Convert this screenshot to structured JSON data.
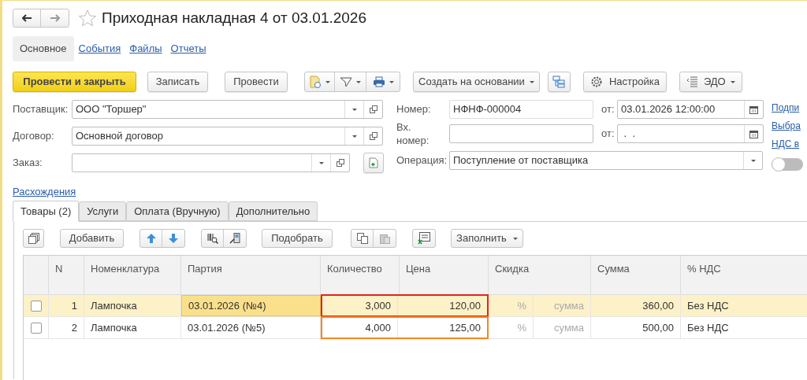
{
  "title": "Приходная накладная 4 от 03.01.2026",
  "sections": [
    {
      "label": "Основное",
      "selected": true
    },
    {
      "label": "События",
      "selected": false
    },
    {
      "label": "Файлы",
      "selected": false
    },
    {
      "label": "Отчеты",
      "selected": false
    }
  ],
  "toolbar": {
    "post_close": "Провести и закрыть",
    "save": "Записать",
    "post": "Провести",
    "create_based": "Создать на основании",
    "settings": "Настройка",
    "edo": "ЭДО"
  },
  "left_fields": [
    {
      "label": "Поставщик:",
      "value": "ООО \"Торшер\""
    },
    {
      "label": "Договор:",
      "value": "Основной договор"
    },
    {
      "label": "Заказ:"
    }
  ],
  "discrepancies_link": "Расхождения",
  "number": {
    "label": "Номер:",
    "value": "НФНФ-000004"
  },
  "date": {
    "label": "от:",
    "value": "03.01.2026 12:00:00"
  },
  "in_number": {
    "label": "Вх. номер:"
  },
  "in_date": {
    "label": "от:",
    "value": " .  ."
  },
  "operation": {
    "label": "Операция:",
    "value": "Поступление от поставщика"
  },
  "side_links": [
    "Подпи",
    "Выбра",
    "НДС в"
  ],
  "side_toggle": {
    "on": false
  },
  "tabs": [
    {
      "label": "Товары (2)",
      "selected": true
    },
    {
      "label": "Услуги",
      "selected": false
    },
    {
      "label": "Оплата (Вручную)",
      "selected": false
    },
    {
      "label": "Дополнительно",
      "selected": false
    }
  ],
  "table_toolbar": {
    "add": "Добавить",
    "pick": "Подобрать",
    "fill": "Заполнить"
  },
  "columns": [
    "N",
    "Номенклатура",
    "Партия",
    "Количество",
    "Цена",
    "Скидка",
    "Сумма",
    "% НДС"
  ],
  "rows": [
    {
      "checked": false,
      "selected": true,
      "n": "1",
      "item": "Лампочка",
      "batch": "03.01.2026 (№4)",
      "quantity": "3,000",
      "price": "120,00",
      "discount_percent": "%",
      "discount_sum": "сумма",
      "sum": "360,00",
      "vat": "Без НДС",
      "color": "#e8211a"
    },
    {
      "checked": false,
      "selected": false,
      "n": "2",
      "item": "Лампочка",
      "batch": "03.01.2026 (№5)",
      "quantity": "4,000",
      "price": "125,00",
      "discount_percent": "%",
      "discount_sum": "сумма",
      "sum": "500,00",
      "vat": "Без НДС",
      "color": "#f5861f"
    }
  ]
}
